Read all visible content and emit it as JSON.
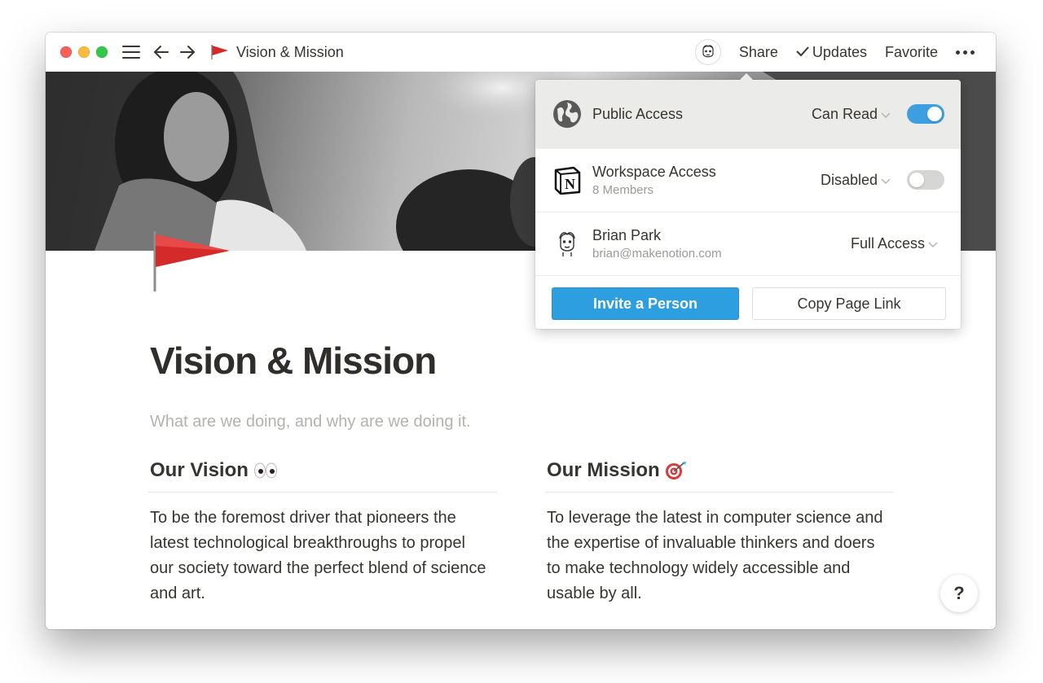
{
  "titlebar": {
    "page_name": "Vision & Mission",
    "share_label": "Share",
    "updates_label": "Updates",
    "favorite_label": "Favorite"
  },
  "icons": {
    "page": "red-flag-icon",
    "menu": "hamburger-icon",
    "more": "more-dots-icon",
    "help": "?"
  },
  "page": {
    "title": "Vision & Mission",
    "subtitle": "What are we doing, and why are we doing it.",
    "vision": {
      "heading": "Our Vision",
      "emoji": "eyes",
      "text": "To be the foremost driver that pioneers the latest technological breakthroughs to propel our society toward the perfect blend of science and art."
    },
    "mission": {
      "heading": "Our Mission",
      "emoji": "direct-hit",
      "text": "To leverage the latest in computer science and the expertise of invaluable thinkers and doers to make technology widely accessible and usable by all."
    }
  },
  "share": {
    "public": {
      "title": "Public Access",
      "permission": "Can Read",
      "enabled": true
    },
    "workspace": {
      "title": "Workspace Access",
      "sub": "8 Members",
      "permission": "Disabled",
      "enabled": false
    },
    "person": {
      "name": "Brian Park",
      "email": "brian@makenotion.com",
      "permission": "Full Access"
    },
    "invite_label": "Invite a Person",
    "copy_link_label": "Copy Page Link"
  },
  "colors": {
    "accent": "#2d9ee0",
    "toggle_on": "#3d9fe0",
    "flag_red": "#d42a2a",
    "text": "#37352f",
    "muted": "#9b9a97"
  }
}
